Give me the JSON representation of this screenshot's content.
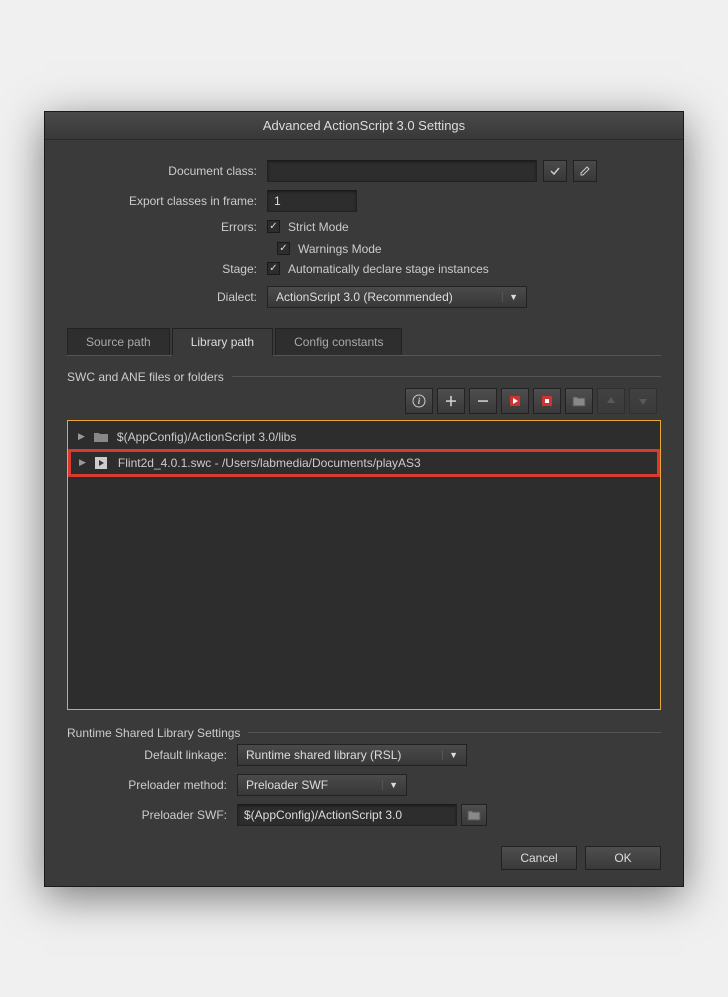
{
  "window": {
    "title": "Advanced ActionScript 3.0 Settings"
  },
  "form": {
    "document_class_label": "Document class:",
    "document_class_value": "",
    "export_frame_label": "Export classes in frame:",
    "export_frame_value": "1",
    "errors_label": "Errors:",
    "strict_mode_label": "Strict Mode",
    "strict_mode_checked": true,
    "warnings_mode_label": "Warnings Mode",
    "warnings_mode_checked": true,
    "stage_label": "Stage:",
    "auto_declare_label": "Automatically declare stage instances",
    "auto_declare_checked": true,
    "dialect_label": "Dialect:",
    "dialect_value": "ActionScript 3.0 (Recommended)"
  },
  "tabs": {
    "source_path": "Source path",
    "library_path": "Library path",
    "config_constants": "Config constants"
  },
  "swc_section": {
    "header": "SWC and ANE files or folders",
    "items": [
      {
        "label": "$(AppConfig)/ActionScript 3.0/libs",
        "icon": "folder"
      },
      {
        "label": "Flint2d_4.0.1.swc - /Users/labmedia/Documents/playAS3",
        "icon": "swc"
      }
    ]
  },
  "runtime": {
    "header": "Runtime Shared Library Settings",
    "default_linkage_label": "Default linkage:",
    "default_linkage_value": "Runtime shared library (RSL)",
    "preloader_method_label": "Preloader method:",
    "preloader_method_value": "Preloader SWF",
    "preloader_swf_label": "Preloader SWF:",
    "preloader_swf_value": "$(AppConfig)/ActionScript 3.0"
  },
  "footer": {
    "cancel": "Cancel",
    "ok": "OK"
  }
}
